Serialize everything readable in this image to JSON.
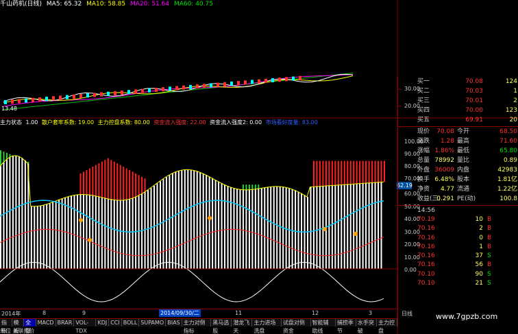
{
  "title_bar": {
    "stock": "千山药机(日线)",
    "ma5": "MA5: 65.32",
    "ma10": "MA10: 58.85",
    "ma20": "MA20: 51.64",
    "ma60": "MA60: 40.75"
  },
  "indicator_bar": {
    "name": "主力状态",
    "p0": "1.00",
    "p1": "散户套牢系数: 19.00",
    "p2": "主力控盘系数: 80.00",
    "p3": "资金流入强度: 22.00",
    "p4": "资金流入强度2: 0.00",
    "p5": "市场看好度量: 83.00"
  },
  "y_axis_top": [
    "30.00",
    "20.00"
  ],
  "y_axis_bottom": [
    "100.00",
    "90.00",
    "80.00",
    "70.00",
    "60.00",
    "50.00",
    "40.00",
    "30.00",
    "20.00",
    "10.00",
    "0.00"
  ],
  "current_value_tag": "62.19",
  "low_price_label": "13.48",
  "date_axis": [
    "2014年",
    "8",
    "9",
    "2014/09/30/二",
    "11",
    "12",
    "3",
    "日线"
  ],
  "bottom_tabs": [
    "指标",
    "模板",
    "全部",
    "MACD",
    "BRAR",
    "VOL-TDX",
    "KDJ",
    "CCI",
    "BOLL",
    "SUPAMO",
    "BIAS",
    "主力对倒指标",
    "黑马选股",
    "潜龙飞天",
    "主力进场洗盘",
    "试盘对倒资金",
    "智能辅助线",
    "捕捞季节",
    "水手突破",
    "主力控盘"
  ],
  "bottom_strip": "单位 关联报价",
  "order_book": {
    "buy": [
      {
        "label": "买一",
        "price": "70.08",
        "vol": "124"
      },
      {
        "label": "买二",
        "price": "70.03",
        "vol": "1"
      },
      {
        "label": "买三",
        "price": "70.01",
        "vol": "2"
      },
      {
        "label": "买四",
        "price": "70.00",
        "vol": "123"
      },
      {
        "label": "买五",
        "price": "69.91",
        "vol": "20"
      }
    ]
  },
  "quote": [
    {
      "l1": "现价",
      "v1": "70.08",
      "l2": "今开",
      "v2": "68.50"
    },
    {
      "l1": "涨跌",
      "v1": "1.28",
      "l2": "最高",
      "v2": "71.60"
    },
    {
      "l1": "涨幅",
      "v1": "1.86%",
      "l2": "最低",
      "v2": "65.80"
    },
    {
      "l1": "总量",
      "v1": "78992",
      "l2": "量比",
      "v2": "0.89"
    },
    {
      "l1": "外盘",
      "v1": "36009",
      "l2": "内盘",
      "v2": "42983"
    },
    {
      "l1": "换手",
      "v1": "6.48%",
      "l2": "股本",
      "v2": "1.81亿"
    },
    {
      "l1": "净资",
      "v1": "4.77",
      "l2": "流通",
      "v2": "1.22亿"
    },
    {
      "l1": "收益(三)",
      "v1": "0.291",
      "l2": "PE(动)",
      "v2": "100.8"
    }
  ],
  "ticks": {
    "time": "14:56",
    "rows": [
      {
        "price": "70.19",
        "vol": "10",
        "flag": "B"
      },
      {
        "price": "70.16",
        "vol": "2",
        "flag": "B"
      },
      {
        "price": "70.16",
        "vol": "0",
        "flag": "B"
      },
      {
        "price": "70.16",
        "vol": "1",
        "flag": "B"
      },
      {
        "price": "70.16",
        "vol": "37",
        "flag": "S"
      },
      {
        "price": "70.16",
        "vol": "56",
        "flag": "B"
      },
      {
        "price": "70.10",
        "vol": "90",
        "flag": "S"
      },
      {
        "price": "70.10",
        "vol": "21",
        "flag": "S"
      }
    ]
  },
  "watermark": "www.7gpzb.com",
  "colors": {
    "up": "#ff3232",
    "down": "#00e600",
    "ma5": "#ffffff",
    "ma10": "#ffff00",
    "ma20": "#ff00ff",
    "ma60": "#00ff00",
    "border": "#800000"
  }
}
